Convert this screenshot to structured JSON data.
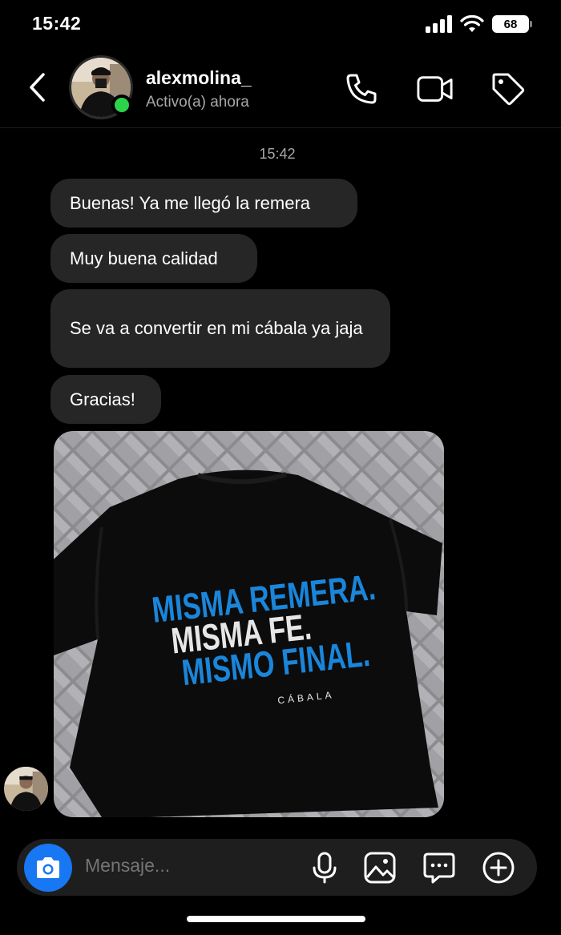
{
  "status_bar": {
    "time": "15:42",
    "battery": "68",
    "icons": [
      "cellular-signal-icon",
      "wifi-icon",
      "battery-icon"
    ]
  },
  "header": {
    "contact_name": "alexmolina_",
    "contact_status": "Activo(a) ahora",
    "online": true,
    "icons": [
      "back-chevron-icon",
      "phone-icon",
      "video-camera-icon",
      "tag-icon"
    ]
  },
  "conversation": {
    "timestamp": "15:42",
    "messages": [
      {
        "text": "Buenas! Ya me llegó la remera"
      },
      {
        "text": "Muy buena calidad"
      },
      {
        "text": "Se va a convertir en mi cábala ya jaja"
      },
      {
        "text": "Gracias!"
      }
    ],
    "photo": {
      "description_icon": "tshirt-photo",
      "shirt_lines": [
        "MISMA REMERA.",
        "MISMA FE.",
        "MISMO FINAL."
      ],
      "brand": "CÁBALA",
      "colors": {
        "blue": "#1a86db",
        "white": "#e6e6e6",
        "shirt": "#0c0c0c"
      }
    }
  },
  "composer": {
    "placeholder": "Mensaje...",
    "icons": [
      "camera-icon",
      "microphone-icon",
      "gallery-icon",
      "sticker-icon",
      "plus-icon"
    ]
  },
  "colors": {
    "background": "#000000",
    "bubble": "#262626",
    "online": "#2bd44a",
    "camera_button": "#1877f2",
    "muted_text": "#a8a8a8"
  }
}
